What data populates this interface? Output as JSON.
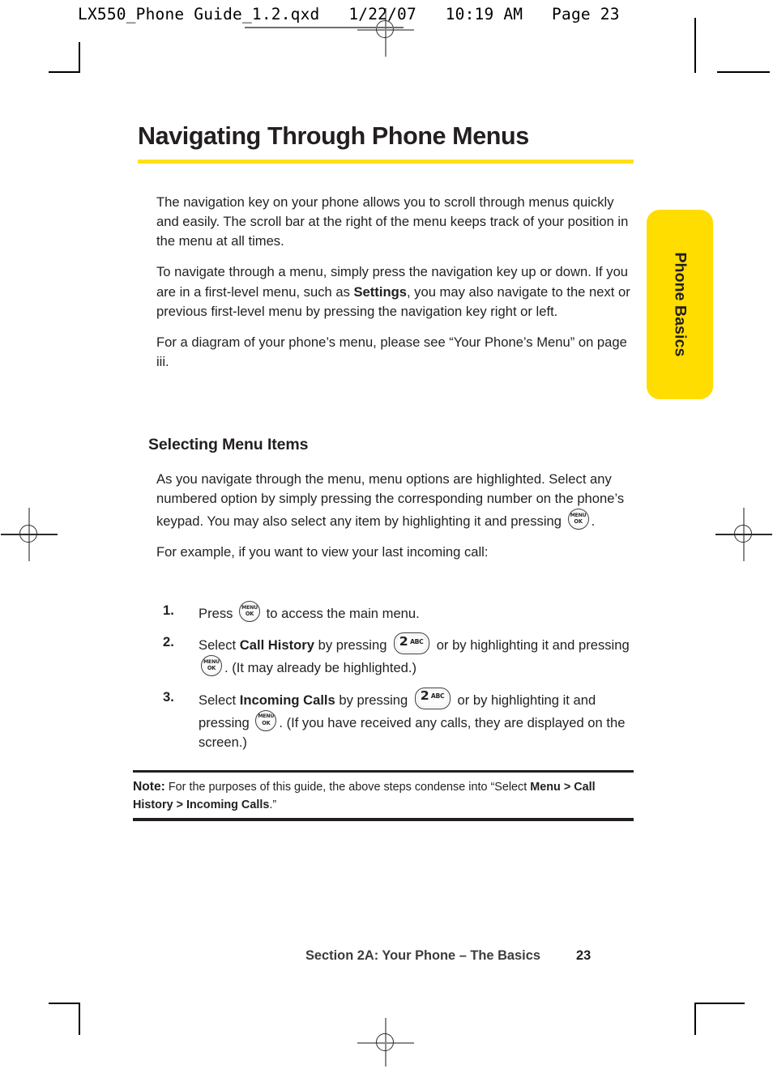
{
  "file_header": {
    "text": "LX550_Phone Guide_1.2.qxd   1/22/07   10:19 AM   Page 23"
  },
  "page": {
    "title": "Navigating Through Phone Menus",
    "accent_color": "#ffe01a",
    "tab_color": "#ffdd00",
    "paragraphs": [
      "The navigation key on your phone allows you to scroll through menus quickly and easily. The scroll bar at the right of the menu keeps track of your position in the menu at all times.",
      "To navigate through a menu, simply press the navigation key up or down. If you are in a first-level menu, such as ",
      ", you may also navigate to the next or previous first-level menu by pressing the navigation key right or left.",
      "For a diagram of your phone’s menu, please see “Your Phone’s Menu” on page iii."
    ],
    "settings_bold": "Settings",
    "subhead": "Selecting Menu Items",
    "select_para_a": "As you navigate through the menu, menu options are highlighted. Select any numbered option by simply pressing the corresponding number on the phone’s keypad. You may also select any item by highlighting it and pressing",
    "select_para_a_end": ".",
    "example_intro": "For example, if you want to view your last incoming call:",
    "steps": [
      {
        "num": "1.",
        "pre": "Press",
        "icon": "menu-ok-key-icon",
        "post": "to access the main menu.",
        "tail": ""
      },
      {
        "num": "2.",
        "pre": "Select",
        "bold": "Call History",
        "mid": "by pressing",
        "icon2": "two-abc-key-icon",
        "mid2": "or by highlighting it and pressing",
        "icon": "menu-ok-key-icon",
        "post": ". (It may already be highlighted.)"
      },
      {
        "num": "3.",
        "pre": "Select",
        "bold": "Incoming Calls",
        "mid": "by pressing",
        "icon2": "two-abc-key-icon",
        "mid2": "or by highlighting it and pressing",
        "icon": "menu-ok-key-icon",
        "post": ". (If you have received any calls, they are displayed on the screen.)"
      }
    ],
    "note": {
      "label": "Note:",
      "text_a": "For the purposes of this guide, the above steps condense into “Select ",
      "path": "Menu > Call History > Incoming Calls",
      "text_b": ".”"
    },
    "side_tab_label": "Phone Basics",
    "footer": {
      "section": "Section 2A: Your Phone – The Basics",
      "page_number": "23"
    }
  },
  "keys": {
    "menu_ok": {
      "line1": "MENU",
      "line2": "OK"
    },
    "two_abc": {
      "digit": "2",
      "letters": "ABC"
    }
  }
}
